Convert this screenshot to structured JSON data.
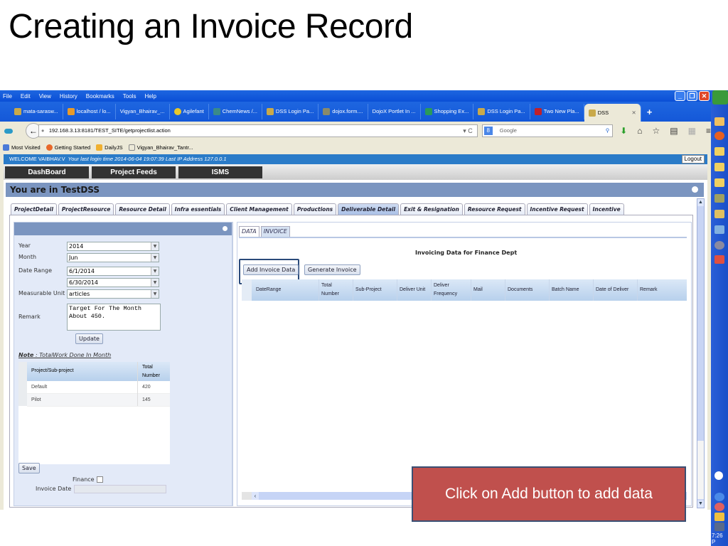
{
  "slide": {
    "title": "Creating an Invoice Record",
    "callout": "Click on Add button to add data"
  },
  "browser": {
    "menu": [
      "File",
      "Edit",
      "View",
      "History",
      "Bookmarks",
      "Tools",
      "Help"
    ],
    "tabs": [
      {
        "label": "mata-sarasw...",
        "icon": "site-icon"
      },
      {
        "label": "localhost / lo...",
        "icon": "phpmyadmin-icon"
      },
      {
        "label": "Vigyan_Bhairav_...",
        "icon": ""
      },
      {
        "label": "Agilefant",
        "icon": "shield-icon"
      },
      {
        "label": "ChemNews /...",
        "icon": "site-icon"
      },
      {
        "label": "DSS Login Pa...",
        "icon": "dss-icon"
      },
      {
        "label": "dojox.form....",
        "icon": "site-icon"
      },
      {
        "label": "DojoX Portlet In ...",
        "icon": ""
      },
      {
        "label": "Shopping Ex...",
        "icon": "site-icon"
      },
      {
        "label": "DSS Login Pa...",
        "icon": "dss-icon"
      },
      {
        "label": "Two New Pla...",
        "icon": "n-icon"
      }
    ],
    "active_tab": "DSS",
    "url": "192.168.3.13:8181/TEST_SITE/getprojectlist.action",
    "search_placeholder": "Google",
    "bookmarks": [
      "Most Visited",
      "Getting Started",
      "DailyJS",
      "Vigyan_Bhairav_Tantr..."
    ],
    "clock": "7:26 P"
  },
  "app": {
    "welcome": "WELCOME  VAIBHAV.V",
    "last_login": "Your last login time 2014-06-04 19:07:39 Last IP Address 127.0.0.1",
    "logout_label": "Logout",
    "main_nav": [
      "DashBoard",
      "Project Feeds",
      "ISMS"
    ],
    "location": "You are in TestDSS",
    "module_tabs": [
      "ProjectDetail",
      "ProjectResource",
      "Resource Detail",
      "Infra essentials",
      "Client Management",
      "Productions",
      "Deliverable Detail",
      "Exit & Resignation",
      "Resource Request",
      "Incentive Request",
      "Incentive"
    ],
    "active_module_tab": "Deliverable Detail"
  },
  "form": {
    "year_label": "Year",
    "year": "2014",
    "month_label": "Month",
    "month": "Jun",
    "date_range_label": "Date Range",
    "date_from": "6/1/2014",
    "date_to": "6/30/2014",
    "unit_label": "Measurable Unit",
    "unit": "articles",
    "remark_label": "Remark",
    "remark": "Target For The Month About 450.",
    "update_label": "Update",
    "note_prefix": "Note",
    "note": " : TotalWork Done In Month",
    "work_table": {
      "headers": [
        "Project/Sub-project",
        "Total",
        "Number"
      ],
      "rows": [
        {
          "name": "Default",
          "total": "420"
        },
        {
          "name": "Pilot",
          "total": "145"
        }
      ]
    },
    "save_label": "Save",
    "finance_label": "Finance",
    "invoice_date_label": "Invoice Date"
  },
  "invoice": {
    "subtabs": [
      "DATA",
      "INVOICE"
    ],
    "active_subtab": "INVOICE",
    "title": "Invoicing Data for Finance Dept",
    "add_label": "Add Invoice Data",
    "generate_label": "Generate Invoice",
    "columns": [
      "DateRange",
      "Total Number",
      "Sub-Project",
      "Deliver Unit",
      "Deliver Frequency",
      "Mail",
      "Documents",
      "Batch Name",
      "Date of Deliver",
      "Remark"
    ]
  }
}
